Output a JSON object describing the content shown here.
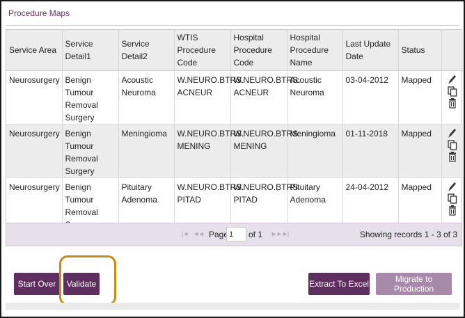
{
  "panel": {
    "title": "Procedure Maps"
  },
  "columns": [
    "Service Area",
    "Service Detail1",
    "Service Detail2",
    "WTIS Procedure Code",
    "Hospital Procedure Code",
    "Hospital Procedure Name",
    "Last Update Date",
    "Status"
  ],
  "rows": [
    {
      "service_area": "Neurosurgery",
      "detail1": "Benign Tumour Removal Surgery",
      "detail2": "Acoustic Neuroma",
      "wtis_code": "W.NEURO.BTRS. ACNEUR",
      "hosp_code": "W.NEURO.BTRS. ACNEUR",
      "hosp_name": "Acoustic Neuroma",
      "updated": "03-04-2012",
      "status": "Mapped"
    },
    {
      "service_area": "Neurosurgery",
      "detail1": "Benign Tumour Removal Surgery",
      "detail2": "Meningioma",
      "wtis_code": "W.NEURO.BTRS. MENING",
      "hosp_code": "W.NEURO.BTRS. MENING",
      "hosp_name": "Meningioma",
      "updated": "01-11-2018",
      "status": "Mapped"
    },
    {
      "service_area": "Neurosurgery",
      "detail1": "Benign Tumour Removal Surgery",
      "detail2": "Pituitary Adenoma",
      "wtis_code": "W.NEURO.BTRS. PITAD",
      "hosp_code": "W.NEURO.BTRS. PITAD",
      "hosp_name": "Pituitary Adenoma",
      "updated": "24-04-2012",
      "status": "Mapped"
    }
  ],
  "row_actions": {
    "icons": [
      "pencil-icon",
      "copy-icon",
      "trash-icon"
    ]
  },
  "pager": {
    "first": "|◄",
    "prev": "◄◄",
    "page_label": "Page",
    "page_value": "1",
    "of_label": "of 1",
    "next": "►►",
    "last": "►|",
    "records": "Showing records 1 - 3 of 3"
  },
  "buttons": {
    "start_over": "Start Over",
    "validate": "Validate",
    "extract": "Extract To Excel",
    "migrate": "Migrate to Production"
  },
  "colors": {
    "brand": "#5e2f5e",
    "brand_muted": "#a889aa",
    "highlight": "#c98a16",
    "pager_bg": "#e7dfe9"
  }
}
